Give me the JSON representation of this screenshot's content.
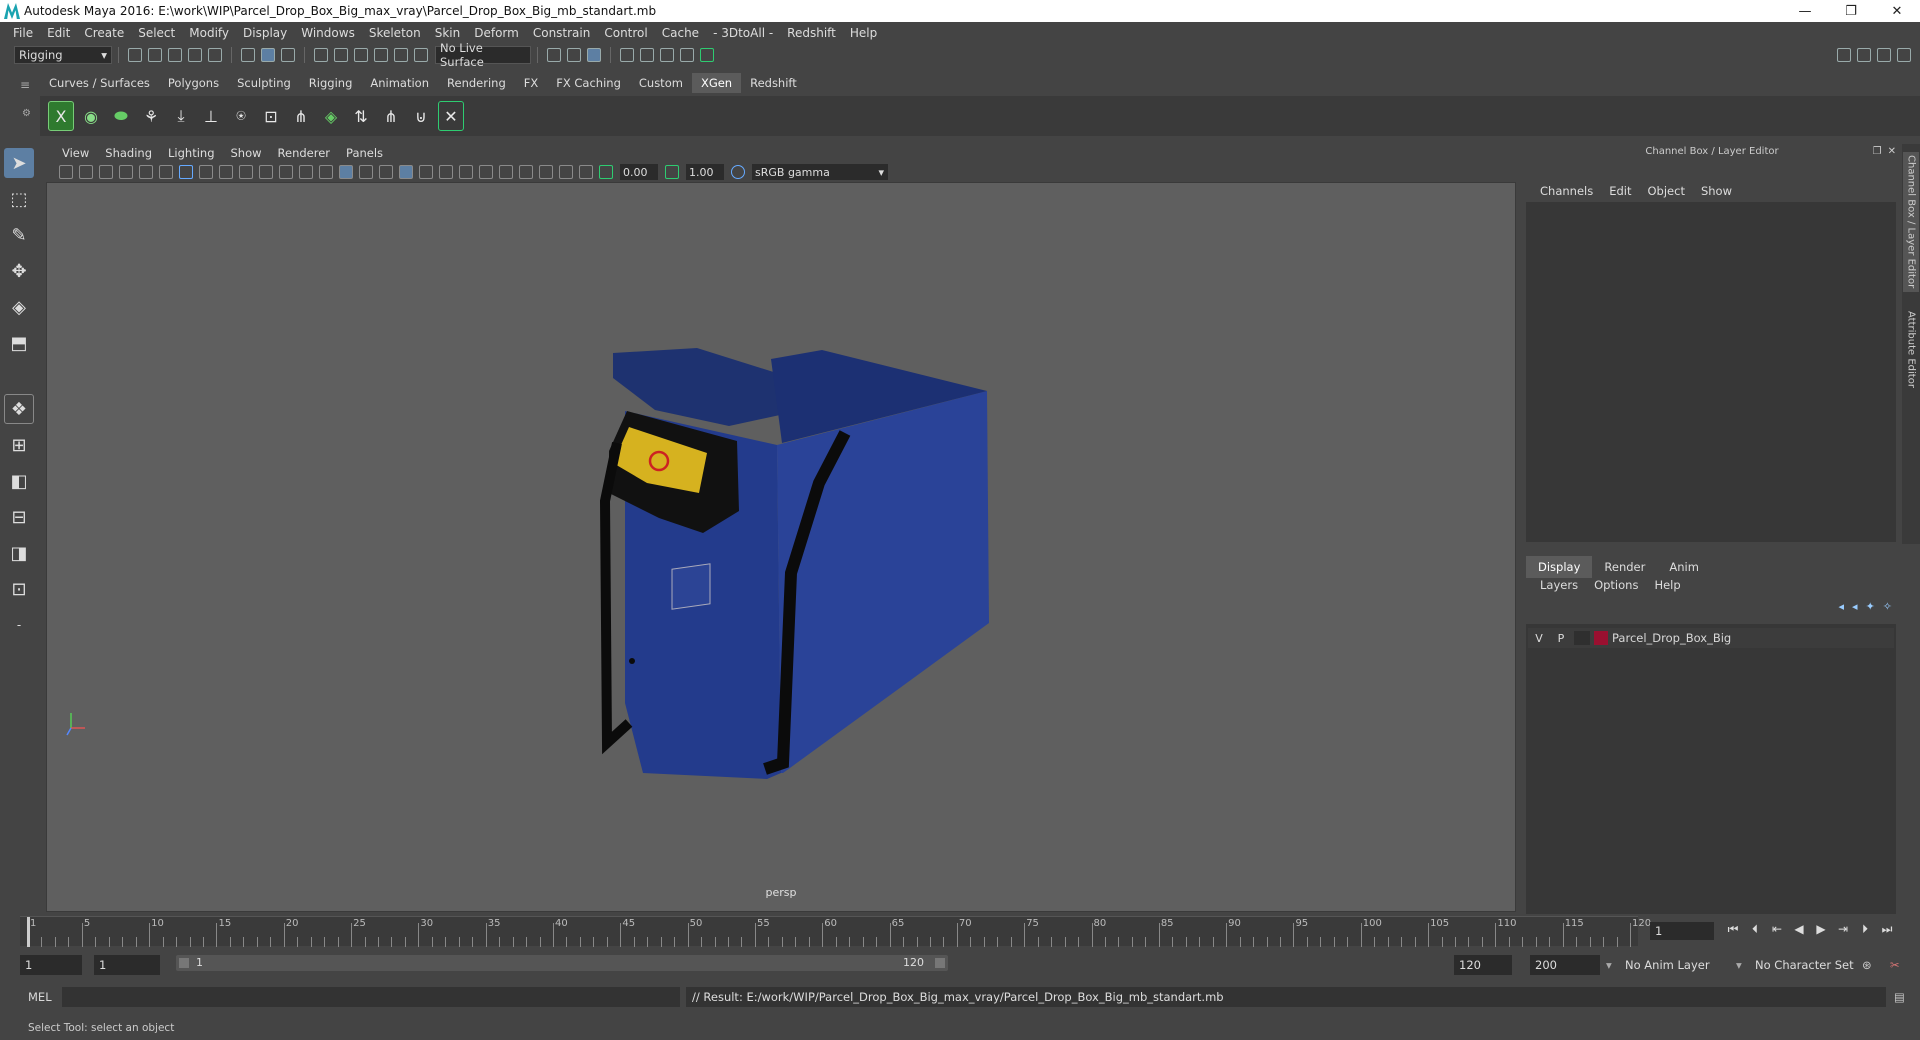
{
  "window": {
    "title": "Autodesk Maya 2016: E:\\work\\WIP\\Parcel_Drop_Box_Big_max_vray\\Parcel_Drop_Box_Big_mb_standart.mb",
    "minimize": "—",
    "restore": "❐",
    "close": "✕"
  },
  "menubar": [
    "File",
    "Edit",
    "Create",
    "Select",
    "Modify",
    "Display",
    "Windows",
    "Skeleton",
    "Skin",
    "Deform",
    "Constrain",
    "Control",
    "Cache",
    "- 3DtoAll -",
    "Redshift",
    "Help"
  ],
  "statusline": {
    "menuset": "Rigging",
    "live_surface": "No Live Surface"
  },
  "shelf_tabs": [
    "Curves / Surfaces",
    "Polygons",
    "Sculpting",
    "Rigging",
    "Animation",
    "Rendering",
    "FX",
    "FX Caching",
    "Custom",
    "XGen",
    "Redshift"
  ],
  "active_shelf_tab": "XGen",
  "panel_menu": [
    "View",
    "Shading",
    "Lighting",
    "Show",
    "Renderer",
    "Panels"
  ],
  "panel_toolbar": {
    "exposure": "0.00",
    "gamma": "1.00",
    "color_space": "sRGB gamma"
  },
  "viewport": {
    "camera_label": "persp",
    "background_color": "#5f5f5f",
    "model_color": "#223a8a"
  },
  "channel_box": {
    "title": "Channel Box / Layer Editor",
    "menu": [
      "Channels",
      "Edit",
      "Object",
      "Show"
    ]
  },
  "layer_editor": {
    "tabs": [
      "Display",
      "Render",
      "Anim"
    ],
    "active_tab": "Display",
    "menu": [
      "Layers",
      "Options",
      "Help"
    ],
    "layers": [
      {
        "v": "V",
        "p": "P",
        "name": "Parcel_Drop_Box_Big",
        "color": "#9a1030"
      }
    ]
  },
  "side_tabs": [
    "Channel Box / Layer Editor",
    "Attribute Editor"
  ],
  "time_slider": {
    "tick_labels": [
      "1",
      "5",
      "10",
      "15",
      "20",
      "25",
      "30",
      "35",
      "40",
      "45",
      "50",
      "55",
      "60",
      "65",
      "70",
      "75",
      "80",
      "85",
      "90",
      "95",
      "100",
      "105",
      "110",
      "115",
      "120"
    ],
    "current_frame": "1"
  },
  "range_slider": {
    "start": "1",
    "playback_start": "1",
    "range_start_label": "1",
    "range_end_label": "120",
    "playback_end": "120",
    "end": "200",
    "anim_layer": "No Anim Layer",
    "character_set": "No Character Set"
  },
  "command_line": {
    "mode": "MEL",
    "result": "// Result: E:/work/WIP/Parcel_Drop_Box_Big_max_vray/Parcel_Drop_Box_Big_mb_standart.mb"
  },
  "help_line": "Select Tool: select an object"
}
